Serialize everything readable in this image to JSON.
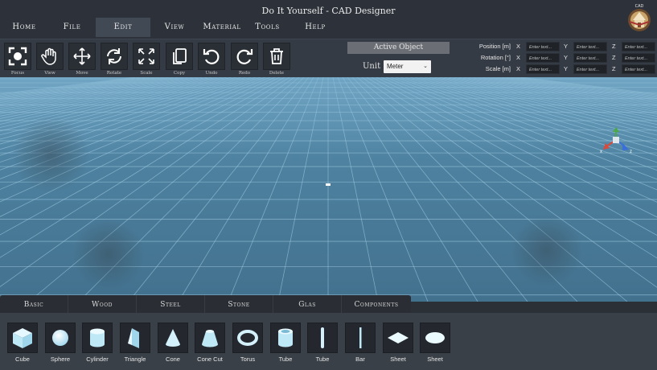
{
  "window": {
    "title": "Do It Yourself - CAD Designer"
  },
  "menu": [
    {
      "label": "Home",
      "name": "menu-home",
      "active": false
    },
    {
      "label": "File",
      "name": "menu-file",
      "active": false
    },
    {
      "label": "Edit",
      "name": "menu-edit",
      "active": true
    },
    {
      "label": "View",
      "name": "menu-view",
      "active": false
    },
    {
      "label": "Material",
      "name": "menu-material",
      "active": false
    },
    {
      "label": "Tools",
      "name": "menu-tools",
      "active": false
    },
    {
      "label": "Help",
      "name": "menu-help",
      "active": false
    }
  ],
  "toolbar": {
    "tools": [
      {
        "label": "Focus",
        "icon": "focus-icon"
      },
      {
        "label": "View",
        "icon": "hand-icon"
      },
      {
        "label": "Move",
        "icon": "move-arrows-icon"
      },
      {
        "label": "Rotate",
        "icon": "rotate-icon"
      },
      {
        "label": "Scale",
        "icon": "scale-icon"
      },
      {
        "label": "Copy",
        "icon": "copy-icon"
      },
      {
        "label": "Undo",
        "icon": "undo-icon"
      },
      {
        "label": "Redo",
        "icon": "redo-icon"
      },
      {
        "label": "Delete",
        "icon": "trash-icon"
      }
    ],
    "active_object": "Active Object",
    "unit_label": "Unit",
    "unit_value": "Meter"
  },
  "transform": {
    "placeholder": "Enter text...",
    "rows": [
      {
        "label": "Position [m]",
        "axes": [
          "X",
          "Y",
          "Z"
        ]
      },
      {
        "label": "Rotation [°]",
        "axes": [
          "X",
          "Y",
          "Z"
        ]
      },
      {
        "label": "Scale [m]",
        "axes": [
          "X",
          "Y",
          "Z"
        ]
      }
    ]
  },
  "gizmo": {
    "x_label": "x",
    "z_label": "z"
  },
  "categories": [
    {
      "label": "Basic"
    },
    {
      "label": "Wood"
    },
    {
      "label": "Steel"
    },
    {
      "label": "Stone"
    },
    {
      "label": "Glas"
    },
    {
      "label": "Components"
    }
  ],
  "shapes": [
    {
      "label": "Cube",
      "icon": "cube-icon"
    },
    {
      "label": "Sphere",
      "icon": "sphere-icon"
    },
    {
      "label": "Cylinder",
      "icon": "cylinder-icon"
    },
    {
      "label": "Triangle",
      "icon": "triangle-prism-icon"
    },
    {
      "label": "Cone",
      "icon": "cone-icon"
    },
    {
      "label": "Cone Cut",
      "icon": "cone-cut-icon"
    },
    {
      "label": "Torus",
      "icon": "torus-icon"
    },
    {
      "label": "Tube",
      "icon": "tube-icon"
    },
    {
      "label": "Tube",
      "icon": "thin-tube-icon"
    },
    {
      "label": "Bar",
      "icon": "bar-icon"
    },
    {
      "label": "Sheet",
      "icon": "sheet-diamond-icon"
    },
    {
      "label": "Sheet",
      "icon": "sheet-round-icon"
    }
  ],
  "colors": {
    "ui_dark": "#2d323a",
    "toolbar": "#353b44",
    "viewport_sky": "#5d92b3",
    "grid_line": "#a9d4ea",
    "shape_fill": "#bfe8f7",
    "gizmo_x": "#d94a3a",
    "gizmo_y": "#4ca84a",
    "gizmo_z": "#3a6fd9"
  }
}
